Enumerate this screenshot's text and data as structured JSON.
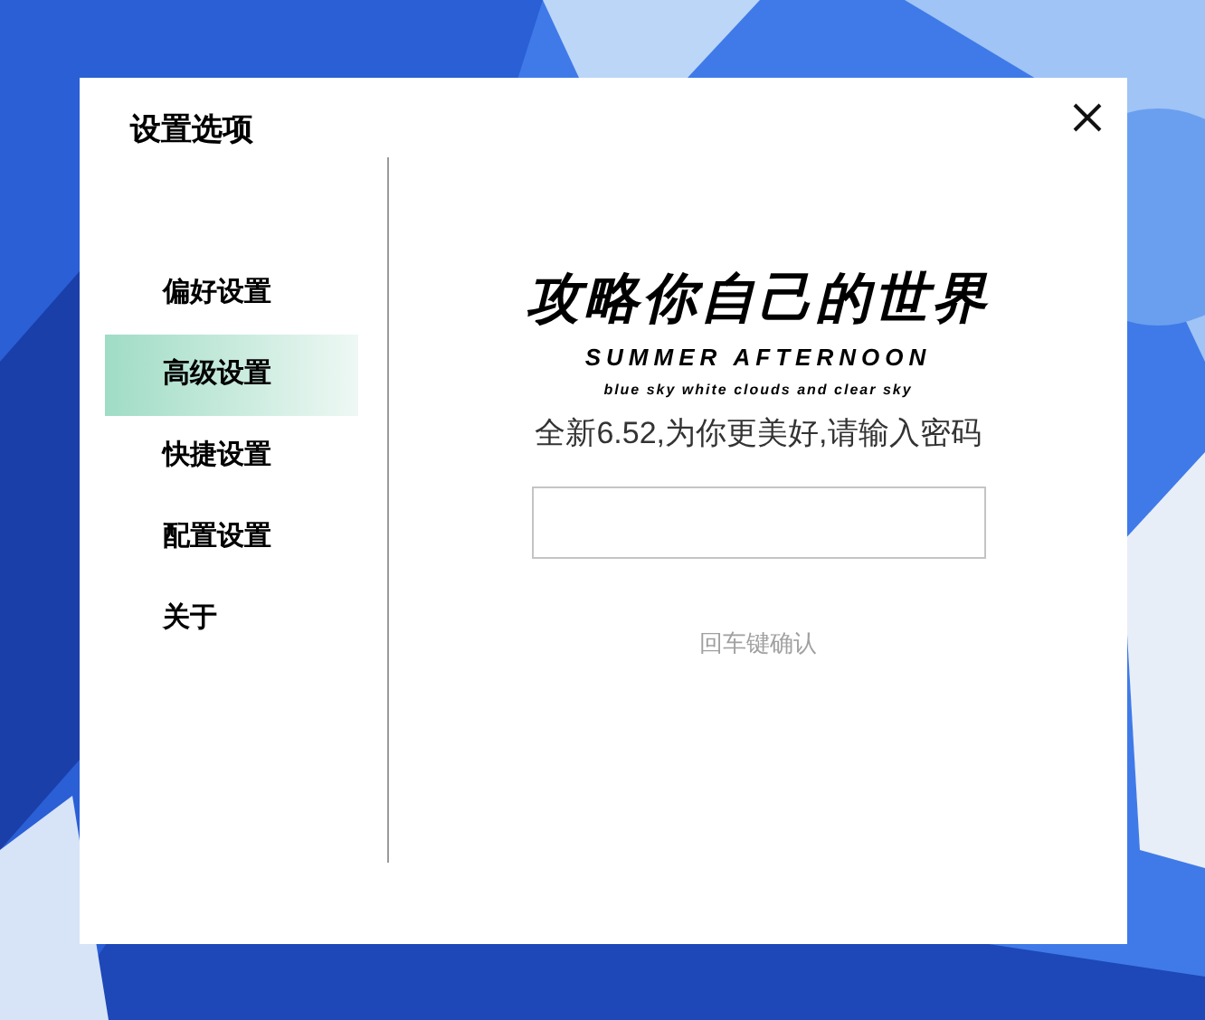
{
  "dialog": {
    "title": "设置选项"
  },
  "sidebar": {
    "items": [
      {
        "label": "偏好设置",
        "selected": false
      },
      {
        "label": "高级设置",
        "selected": true
      },
      {
        "label": "快捷设置",
        "selected": false
      },
      {
        "label": "配置设置",
        "selected": false
      },
      {
        "label": "关于",
        "selected": false
      }
    ]
  },
  "banner": {
    "headline": "攻略你自己的世界",
    "subtitle": "SUMMER AFTERNOON",
    "tagline": "blue sky white clouds and clear sky"
  },
  "prompt": "全新6.52,为你更美好,请输入密码",
  "hint": "回车键确认"
}
